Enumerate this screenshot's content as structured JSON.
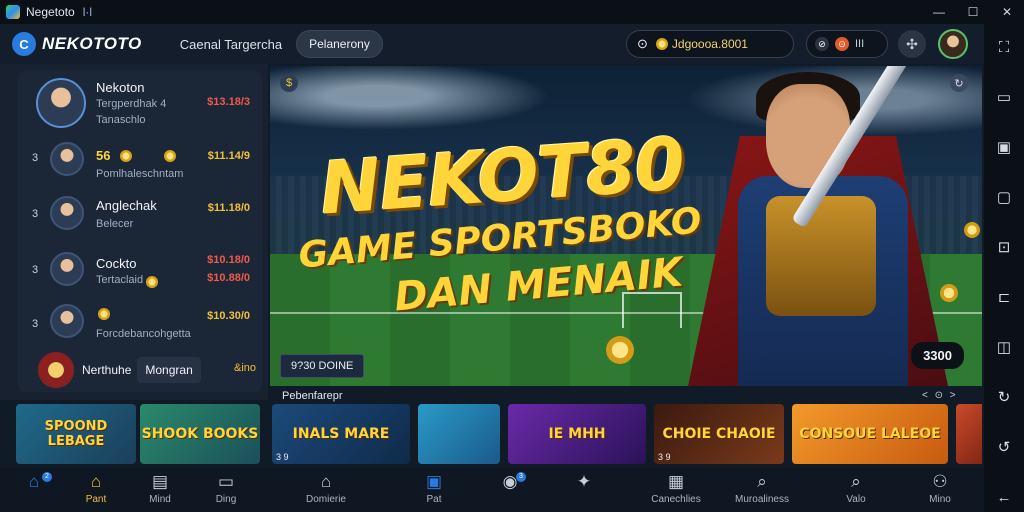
{
  "window": {
    "title": "Negetoto",
    "title_badge": "l·l"
  },
  "window_controls": {
    "minimize": "—",
    "maximize": "☐",
    "close": "✕"
  },
  "header": {
    "logo_text": "NEKOTOTO",
    "nav_link": "Caenal Targercha",
    "nav_pill": "Pelanerony",
    "balance_text": "Jdgoooa.8001",
    "toggle_labels": [
      "⊘",
      "⊙"
    ],
    "toggle_text": "III"
  },
  "leaderboard": {
    "top": {
      "name": "Nekoton",
      "sub": "Tergperdhak 4",
      "sub2": "Tanaschlo",
      "amount": "$13.18/3"
    },
    "rows": [
      {
        "rank": "3",
        "name": "56",
        "sub": "Pomlhaleschntam",
        "amount": "$11.14/9"
      },
      {
        "rank": "3",
        "name": "Anglechak",
        "sub": "Belecer",
        "amount": "$11.18/0"
      },
      {
        "rank": "3",
        "name": "Cockto",
        "sub": "Tertaclaid",
        "amount": "$10.88/0",
        "extra": "$10.18/0"
      },
      {
        "rank": "3",
        "name": "",
        "sub": "Forcdebancohgetta",
        "amount": "$10.30/0"
      }
    ],
    "bottom": {
      "name": "Nerthuhe",
      "badge": "Mongran",
      "value": "&ino"
    }
  },
  "hero": {
    "title": "NEKOT80",
    "sub1": "GAME SPORTSBOKO",
    "sub2": "DAN MENAIK",
    "button": "9?30 DOINE",
    "pill": "3300"
  },
  "games": {
    "label": "Pebenfarepr",
    "controls": "< ⊙ >",
    "left_tiles": [
      {
        "title": "SPOOND LEBAGE"
      },
      {
        "title": "SHOOK BOOKS"
      }
    ],
    "tiles": [
      {
        "title": "INALS MARE",
        "sub": "3 9"
      },
      {
        "title": "",
        "sub": ""
      },
      {
        "title": "IE MHH",
        "sub": ""
      },
      {
        "title": "CHOIE CHAOIE",
        "sub": "3 9"
      },
      {
        "title": "CONSOUE LALEOE",
        "sub": ""
      },
      {
        "title": "",
        "sub": ""
      }
    ]
  },
  "bottom_nav": {
    "items": [
      {
        "label": "",
        "icon": "⌂"
      },
      {
        "label": "Pant",
        "icon": "⌂"
      },
      {
        "label": "Mind",
        "icon": "▤"
      },
      {
        "label": "Ding",
        "icon": "▭"
      },
      {
        "label": "Domierie",
        "icon": "⌂"
      },
      {
        "label": "Pat",
        "icon": "▣"
      },
      {
        "label": "",
        "icon": "◉"
      },
      {
        "label": "",
        "icon": "✦"
      },
      {
        "label": "Canechlies",
        "icon": "▦"
      },
      {
        "label": "Muroaliness",
        "icon": "⌕"
      },
      {
        "label": "Valo",
        "icon": "⌕"
      },
      {
        "label": "Mino",
        "icon": "⚇"
      }
    ]
  },
  "colors": {
    "accent": "#f0c03a",
    "brand_blue": "#2a7be0",
    "bg": "#111a27"
  }
}
